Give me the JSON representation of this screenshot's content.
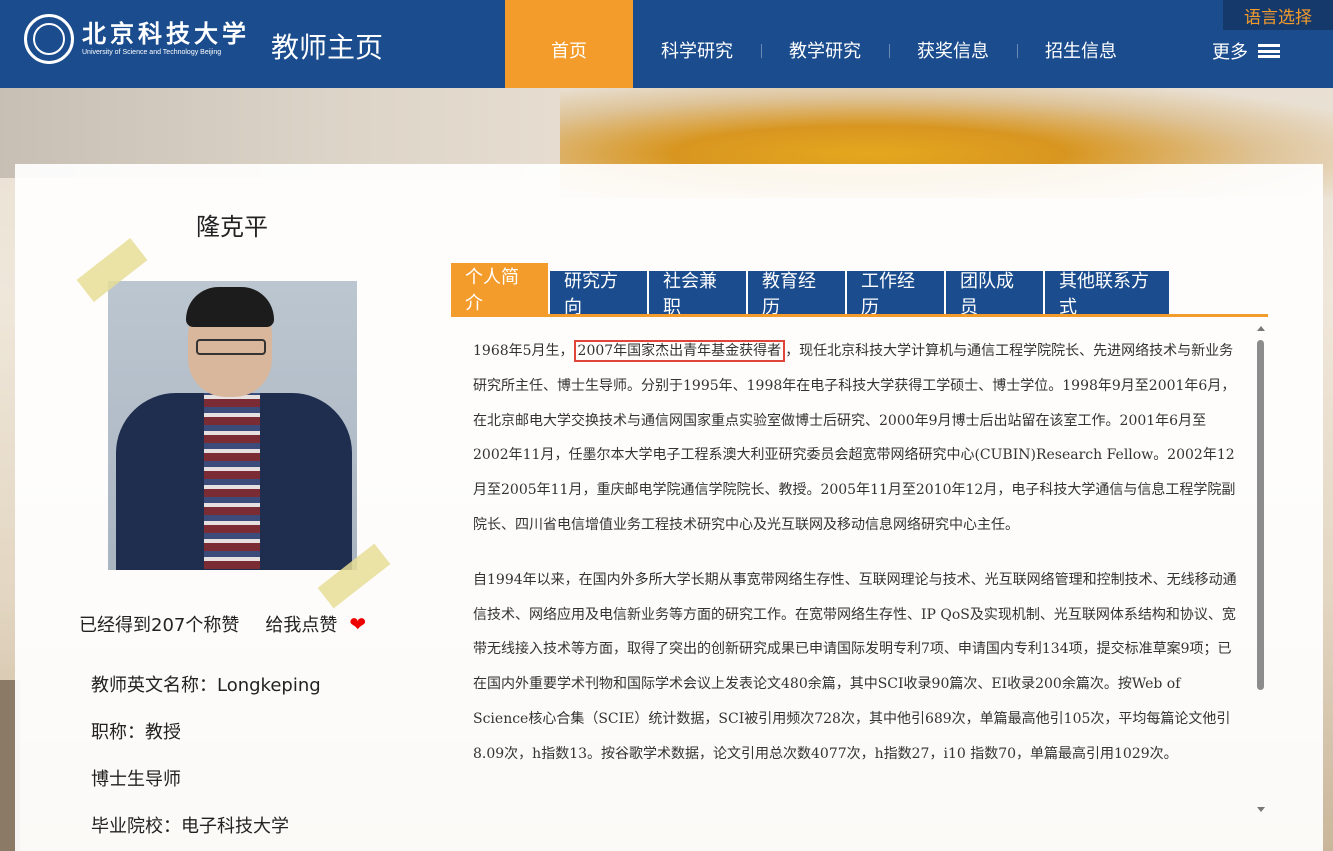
{
  "header": {
    "logo_cn": "北京科技大学",
    "logo_en": "University of Science and Technology Beijing",
    "site_title": "教师主页",
    "nav": [
      "首页",
      "科学研究",
      "教学研究",
      "获奖信息",
      "招生信息"
    ],
    "more_label": "更多",
    "lang_label": "语言选择"
  },
  "profile": {
    "name": "隆克平",
    "likes_text": "已经得到207个称赞",
    "like_button": "给我点赞",
    "info": [
      "教师英文名称：Longkeping",
      "职称：教授",
      "博士生导师",
      "毕业院校：电子科技大学"
    ]
  },
  "tabs": [
    "个人简介",
    "研究方向",
    "社会兼职",
    "教育经历",
    "工作经历",
    "团队成员",
    "其他联系方式"
  ],
  "content": {
    "p1_before": "1968年5月生，",
    "p1_highlight": "2007年国家杰出青年基金获得者",
    "p1_after": "，现任北京科技大学计算机与通信工程学院院长、先进网络技术与新业务研究所主任、博士生导师。分别于1995年、1998年在电子科技大学获得工学硕士、博士学位。1998年9月至2001年6月，在北京邮电大学交换技术与通信网国家重点实验室做博士后研究、2000年9月博士后出站留在该室工作。2001年6月至2002年11月，任墨尔本大学电子工程系澳大利亚研究委员会超宽带网络研究中心(CUBIN)Research Fellow。2002年12月至2005年11月，重庆邮电学院通信学院院长、教授。2005年11月至2010年12月，电子科技大学通信与信息工程学院副院长、四川省电信增值业务工程技术研究中心及光互联网及移动信息网络研究中心主任。",
    "p2": "自1994年以来，在国内外多所大学长期从事宽带网络生存性、互联网理论与技术、光互联网络管理和控制技术、无线移动通信技术、网络应用及电信新业务等方面的研究工作。在宽带网络生存性、IP QoS及实现机制、光互联网体系结构和协议、宽带无线接入技术等方面，取得了突出的创新研究成果已申请国际发明专利7项、申请国内专利134项，提交标准草案9项；已在国内外重要学术刊物和国际学术会议上发表论文480余篇，其中SCI收录90篇次、EI收录200余篇次。按Web of Science核心合集（SCIE）统计数据，SCI被引用频次728次，其中他引689次，单篇最高他引105次，平均每篇论文他引8.09次，h指数13。按谷歌学术数据，论文引用总次数4077次，h指数27，i10 指数70，单篇最高引用1029次。"
  },
  "colors": {
    "primary": "#1b4c8e",
    "accent": "#f49c2b",
    "highlight": "#e0453a"
  }
}
